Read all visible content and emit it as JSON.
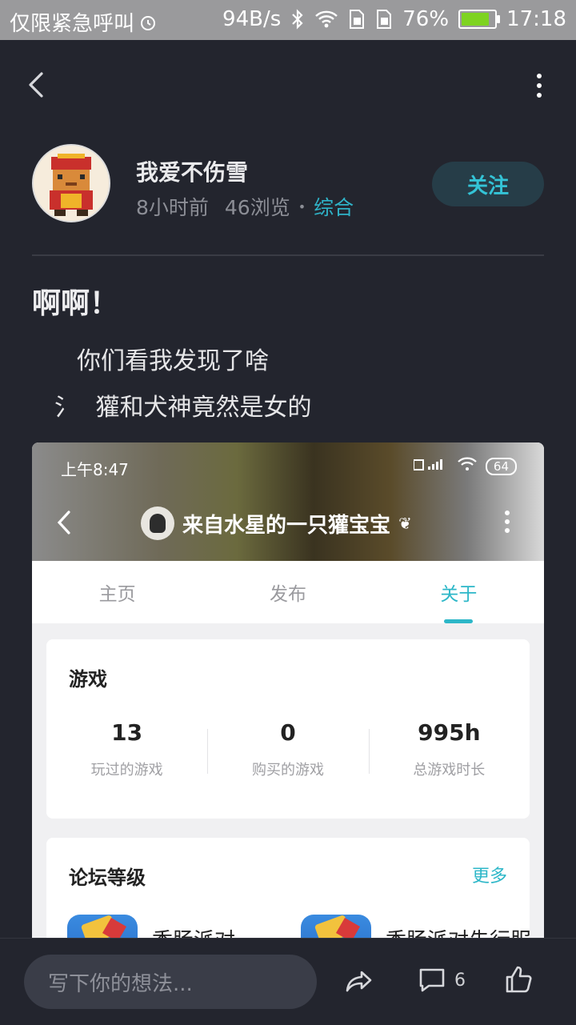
{
  "status_bar": {
    "carrier": "仅限紧急呼叫",
    "speed": "94B/s",
    "battery_pct": "76%",
    "time": "17:18"
  },
  "author": {
    "name": "我爱不伤雪",
    "time_ago": "8小时前",
    "views": "46浏览",
    "separator": "•",
    "category": "综合",
    "follow_label": "关注"
  },
  "post": {
    "title": "啊啊！",
    "line1": "你们看我发现了啥",
    "line2_prefix": "氵",
    "line2": "獾和犬神竟然是女的"
  },
  "screenshot": {
    "status_time": "上午8:47",
    "battery": "64",
    "title": "来自水星的一只獾宝宝",
    "title_suffix": "❦",
    "tabs": [
      {
        "label": "主页"
      },
      {
        "label": "发布"
      },
      {
        "label": "关于"
      }
    ],
    "games_card": {
      "title": "游戏",
      "stats": [
        {
          "value": "13",
          "label": "玩过的游戏"
        },
        {
          "value": "0",
          "label": "购买的游戏"
        },
        {
          "value": "995h",
          "label": "总游戏时长"
        }
      ]
    },
    "forum_card": {
      "title": "论坛等级",
      "more": "更多",
      "items": [
        {
          "name": "香肠派对"
        },
        {
          "name": "香肠派对先行服"
        }
      ]
    }
  },
  "bottom_bar": {
    "input_placeholder": "写下你的想法...",
    "comment_count": "6"
  },
  "colors": {
    "background": "#23252e",
    "accent": "#2fb3c8",
    "follow_bg": "#263d48"
  }
}
